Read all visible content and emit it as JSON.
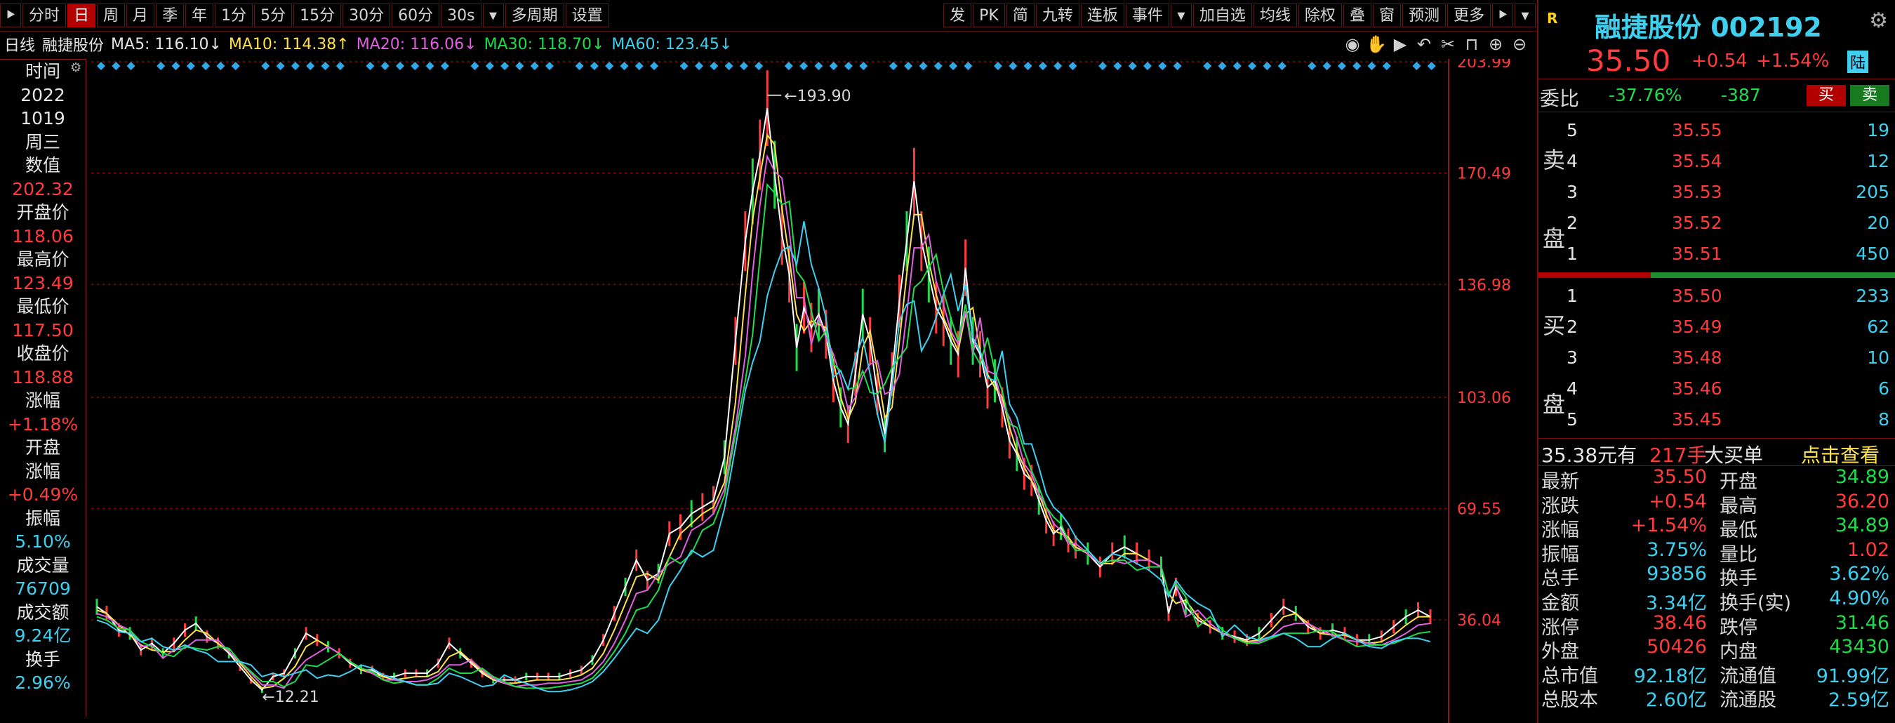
{
  "toolbar": {
    "left_items": [
      "分时",
      "日",
      "周",
      "月",
      "季",
      "年",
      "1分",
      "5分",
      "15分",
      "30分",
      "60分",
      "30s",
      "多周期",
      "设置"
    ],
    "active": "日",
    "right_items": [
      "发",
      "PK",
      "简",
      "九转",
      "连板",
      "事件",
      "加自选",
      "均线",
      "除权",
      "叠",
      "窗",
      "预测",
      "更多"
    ]
  },
  "ma_bar": {
    "period": "日线",
    "stock": "融捷股份",
    "ma5": "MA5: 116.10↓",
    "ma10": "MA10: 114.38↑",
    "ma20": "MA20: 116.06↓",
    "ma30": "MA30: 118.70↓",
    "ma60": "MA60: 123.45↓",
    "tool_icons": [
      "eye-icon",
      "hand-icon",
      "play-icon",
      "undo-icon",
      "scissors-icon",
      "lock-icon",
      "zoom-in-icon",
      "zoom-out-icon"
    ]
  },
  "left_panel": [
    {
      "k": "时间",
      "c": "white"
    },
    {
      "k": "2022",
      "c": "white"
    },
    {
      "k": "1019",
      "c": "white"
    },
    {
      "k": "周三",
      "c": "white"
    },
    {
      "k": "数值",
      "c": "white"
    },
    {
      "k": "202.32",
      "c": "red"
    },
    {
      "k": "开盘价",
      "c": "white"
    },
    {
      "k": "118.06",
      "c": "red"
    },
    {
      "k": "最高价",
      "c": "white"
    },
    {
      "k": "123.49",
      "c": "red"
    },
    {
      "k": "最低价",
      "c": "white"
    },
    {
      "k": "117.50",
      "c": "red"
    },
    {
      "k": "收盘价",
      "c": "white"
    },
    {
      "k": "118.88",
      "c": "red"
    },
    {
      "k": "涨幅",
      "c": "white"
    },
    {
      "k": "+1.18%",
      "c": "red"
    },
    {
      "k": "开盘",
      "c": "white"
    },
    {
      "k": "涨幅",
      "c": "white"
    },
    {
      "k": "+0.49%",
      "c": "red"
    },
    {
      "k": "振幅",
      "c": "white"
    },
    {
      "k": "5.10%",
      "c": "cyan"
    },
    {
      "k": "成交量",
      "c": "white"
    },
    {
      "k": "76709",
      "c": "cyan"
    },
    {
      "k": "成交额",
      "c": "white"
    },
    {
      "k": "9.24亿",
      "c": "cyan"
    },
    {
      "k": "换手",
      "c": "white"
    },
    {
      "k": "2.96%",
      "c": "cyan"
    }
  ],
  "chart_data": {
    "type": "line",
    "y_ticks": [
      203.99,
      170.49,
      136.98,
      103.06,
      69.55,
      36.04
    ],
    "ylim": [
      12.21,
      203.99
    ],
    "annotations": {
      "high": "193.90",
      "low": "12.21"
    },
    "series": [
      {
        "name": "MA5",
        "color": "#ffffff"
      },
      {
        "name": "MA10",
        "color": "#ffe14d"
      },
      {
        "name": "MA20",
        "color": "#e060e0"
      },
      {
        "name": "MA30",
        "color": "#1fdc4a"
      },
      {
        "name": "MA60",
        "color": "#3fd0f0"
      }
    ],
    "close_path": [
      [
        0,
        40
      ],
      [
        0.8,
        38
      ],
      [
        1.8,
        33
      ],
      [
        2.7,
        32
      ],
      [
        3.6,
        27
      ],
      [
        4.5,
        29
      ],
      [
        5.4,
        26
      ],
      [
        6.3,
        29
      ],
      [
        7.2,
        33
      ],
      [
        8.1,
        35
      ],
      [
        9.0,
        31
      ],
      [
        9.9,
        29
      ],
      [
        10.8,
        26
      ],
      [
        11.7,
        22
      ],
      [
        12.6,
        18
      ],
      [
        13.5,
        15
      ],
      [
        14.4,
        19
      ],
      [
        15.3,
        20
      ],
      [
        16.2,
        26
      ],
      [
        17.1,
        32
      ],
      [
        18.0,
        30
      ],
      [
        18.9,
        28
      ],
      [
        19.8,
        26
      ],
      [
        20.7,
        23
      ],
      [
        21.6,
        21
      ],
      [
        22.5,
        21
      ],
      [
        23.4,
        19
      ],
      [
        24.3,
        19
      ],
      [
        25.2,
        20
      ],
      [
        26.1,
        20
      ],
      [
        27.0,
        20
      ],
      [
        27.9,
        23
      ],
      [
        28.8,
        29
      ],
      [
        29.7,
        26
      ],
      [
        30.6,
        23
      ],
      [
        31.5,
        20
      ],
      [
        32.4,
        18
      ],
      [
        33.3,
        18
      ],
      [
        34.2,
        18
      ],
      [
        35.1,
        19
      ],
      [
        36.0,
        19
      ],
      [
        36.9,
        19
      ],
      [
        37.8,
        19
      ],
      [
        38.7,
        20
      ],
      [
        39.6,
        21
      ],
      [
        40.5,
        24
      ],
      [
        41.4,
        30
      ],
      [
        42.3,
        38
      ],
      [
        43.2,
        46
      ],
      [
        44.1,
        54
      ],
      [
        45.0,
        48
      ],
      [
        45.9,
        50
      ],
      [
        46.8,
        62
      ],
      [
        47.7,
        64
      ],
      [
        48.6,
        68
      ],
      [
        49.5,
        70
      ],
      [
        50.4,
        72
      ],
      [
        51.3,
        85
      ],
      [
        52.2,
        120
      ],
      [
        53.0,
        150
      ],
      [
        53.6,
        165
      ],
      [
        54.2,
        176
      ],
      [
        54.8,
        190
      ],
      [
        55.4,
        170
      ],
      [
        56.0,
        152
      ],
      [
        56.6,
        140
      ],
      [
        57.2,
        118
      ],
      [
        57.8,
        130
      ],
      [
        58.4,
        124
      ],
      [
        59.0,
        128
      ],
      [
        59.6,
        122
      ],
      [
        60.2,
        108
      ],
      [
        60.8,
        100
      ],
      [
        61.4,
        95
      ],
      [
        62.0,
        110
      ],
      [
        62.6,
        128
      ],
      [
        63.2,
        120
      ],
      [
        63.8,
        104
      ],
      [
        64.4,
        92
      ],
      [
        65.0,
        110
      ],
      [
        65.6,
        132
      ],
      [
        66.2,
        150
      ],
      [
        66.8,
        168
      ],
      [
        67.4,
        150
      ],
      [
        68.0,
        140
      ],
      [
        68.6,
        130
      ],
      [
        69.2,
        126
      ],
      [
        69.8,
        120
      ],
      [
        70.4,
        116
      ],
      [
        71.0,
        142
      ],
      [
        71.6,
        120
      ],
      [
        72.2,
        116
      ],
      [
        72.8,
        106
      ],
      [
        73.4,
        108
      ],
      [
        74.0,
        100
      ],
      [
        74.6,
        90
      ],
      [
        75.2,
        86
      ],
      [
        75.8,
        80
      ],
      [
        76.4,
        78
      ],
      [
        77.0,
        72
      ],
      [
        77.6,
        66
      ],
      [
        78.2,
        62
      ],
      [
        78.8,
        64
      ],
      [
        79.4,
        60
      ],
      [
        80.0,
        58
      ],
      [
        81.0,
        56
      ],
      [
        82.0,
        52
      ],
      [
        83.0,
        56
      ],
      [
        84.0,
        58
      ],
      [
        85.0,
        56
      ],
      [
        86.0,
        54
      ],
      [
        87.0,
        52
      ],
      [
        87.6,
        38
      ],
      [
        88.2,
        46
      ],
      [
        89.0,
        40
      ],
      [
        90.0,
        36
      ],
      [
        91.0,
        34
      ],
      [
        92.0,
        32
      ],
      [
        93.0,
        31
      ],
      [
        94.0,
        30
      ],
      [
        95.0,
        32
      ],
      [
        96.0,
        36
      ],
      [
        97.0,
        40
      ],
      [
        98.0,
        38
      ],
      [
        99.0,
        34
      ],
      [
        100,
        32
      ],
      [
        101,
        33
      ],
      [
        102,
        32
      ],
      [
        103,
        30
      ],
      [
        104,
        30
      ],
      [
        105,
        31
      ],
      [
        106,
        34
      ],
      [
        107,
        37
      ],
      [
        108,
        39
      ],
      [
        109,
        37
      ]
    ]
  },
  "right_panel": {
    "logo": "R",
    "name": "融捷股份 002192",
    "price": "35.50",
    "change": "+0.54",
    "change_pct": "+1.54%",
    "market_tag": "陆",
    "weibi_label": "委比",
    "weibi_pct": "-37.76%",
    "weibi_val": "-387",
    "buy_label": "买",
    "sell_label": "卖",
    "sell_side": "卖盘",
    "buy_side": "买盘",
    "asks": [
      {
        "lvl": "5",
        "px": "35.55",
        "vol": "19"
      },
      {
        "lvl": "4",
        "px": "35.54",
        "vol": "12"
      },
      {
        "lvl": "3",
        "px": "35.53",
        "vol": "205"
      },
      {
        "lvl": "2",
        "px": "35.52",
        "vol": "20"
      },
      {
        "lvl": "1",
        "px": "35.51",
        "vol": "450"
      }
    ],
    "bids": [
      {
        "lvl": "1",
        "px": "35.50",
        "vol": "233"
      },
      {
        "lvl": "2",
        "px": "35.49",
        "vol": "62"
      },
      {
        "lvl": "3",
        "px": "35.48",
        "vol": "10"
      },
      {
        "lvl": "4",
        "px": "35.46",
        "vol": "6"
      },
      {
        "lvl": "5",
        "px": "35.45",
        "vol": "8"
      }
    ],
    "big_order": {
      "price": "35.38元有",
      "qty": "217手",
      "label": "大买单",
      "link": "点击查看"
    },
    "stats": [
      {
        "k": "最新",
        "v": "35.50",
        "vc": "red",
        "k2": "开盘",
        "v2": "34.89",
        "v2c": "green"
      },
      {
        "k": "涨跌",
        "v": "+0.54",
        "vc": "red",
        "k2": "最高",
        "v2": "36.20",
        "v2c": "red"
      },
      {
        "k": "涨幅",
        "v": "+1.54%",
        "vc": "red",
        "k2": "最低",
        "v2": "34.89",
        "v2c": "green"
      },
      {
        "k": "振幅",
        "v": "3.75%",
        "vc": "cyan",
        "k2": "量比",
        "v2": "1.02",
        "v2c": "red"
      },
      {
        "k": "总手",
        "v": "93856",
        "vc": "cyan",
        "k2": "换手",
        "v2": "3.62%",
        "v2c": "cyan"
      },
      {
        "k": "金额",
        "v": "3.34亿",
        "vc": "cyan",
        "k2": "换手(实)",
        "v2": "4.90%",
        "v2c": "cyan"
      },
      {
        "k": "涨停",
        "v": "38.46",
        "vc": "red",
        "k2": "跌停",
        "v2": "31.46",
        "v2c": "green"
      },
      {
        "k": "外盘",
        "v": "50426",
        "vc": "red",
        "k2": "内盘",
        "v2": "43430",
        "v2c": "green"
      },
      {
        "k": "总市值",
        "v": "92.18亿",
        "vc": "cyan",
        "k2": "流通值",
        "v2": "91.99亿",
        "v2c": "cyan"
      },
      {
        "k": "总股本",
        "v": "2.60亿",
        "vc": "cyan",
        "k2": "流通股",
        "v2": "2.59亿",
        "v2c": "cyan"
      }
    ]
  }
}
